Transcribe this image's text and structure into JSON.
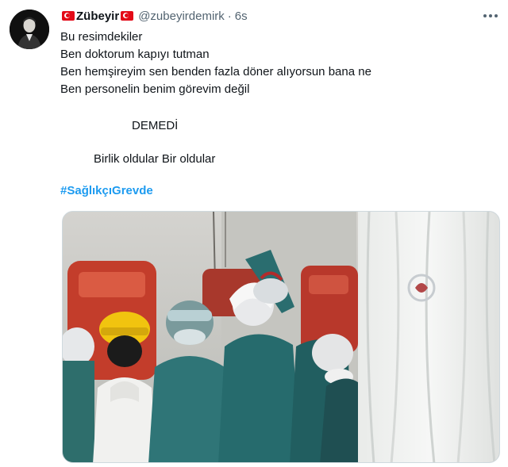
{
  "tweet": {
    "display_name": "Zübeyir",
    "handle": "@zubeyirdemirk",
    "separator": "·",
    "timestamp": "6s",
    "lines": [
      "Bu resimdekiler",
      "Ben doktorum kapıyı tutman",
      "Ben hemşireyim sen benden fazla döner alıyorsun bana ne",
      "Ben personelin benim görevim değil",
      "DEMEDİ",
      "Birlik oldular Bir oldular"
    ],
    "hashtag": "#SağlıkçıGrevde"
  },
  "icons": {
    "flag_left": "turkey-flag-icon",
    "flag_right": "turkey-flag-icon",
    "more": "more-options-icon"
  },
  "colors": {
    "accent": "#1d9bf0",
    "text": "#0f1419",
    "secondary": "#536471",
    "flag_red": "#e30a17"
  }
}
